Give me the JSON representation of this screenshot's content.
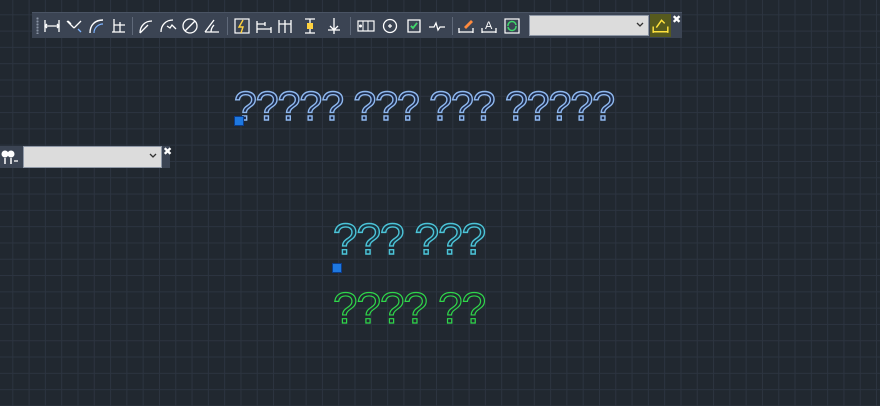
{
  "toolbar": {
    "icons": [
      "linear-dimension-icon",
      "aligned-dimension-icon",
      "arc-length-icon",
      "ordinate-dimension-icon",
      "radius-dimension-icon",
      "jogged-dimension-icon",
      "diameter-dimension-icon",
      "angular-dimension-icon",
      "quick-dimension-icon",
      "baseline-dimension-icon",
      "continue-dimension-icon",
      "dimension-space-icon",
      "dimension-break-icon",
      "tolerance-icon",
      "center-mark-icon",
      "inspection-icon",
      "jogged-linear-icon",
      "dimension-edit-icon",
      "dimension-text-edit-icon",
      "dimension-update-icon",
      "dimension-style-icon"
    ],
    "style_combo_value": "",
    "close_glyph": "✖"
  },
  "side_toolbar": {
    "icon": "multileader-icon",
    "combo_value": "",
    "close_glyph": "✖"
  },
  "canvas": {
    "blue_text": "????? ??? ??? ?????",
    "cyan_text": "??? ???",
    "green_text": "???? ??"
  },
  "colors": {
    "background": "#212830",
    "blue_text": "#8fb8ee",
    "cyan_text": "#4cc4d8",
    "green_text": "#2fd64a",
    "grip": "#1e78e0",
    "highlight": "#565a1e"
  }
}
